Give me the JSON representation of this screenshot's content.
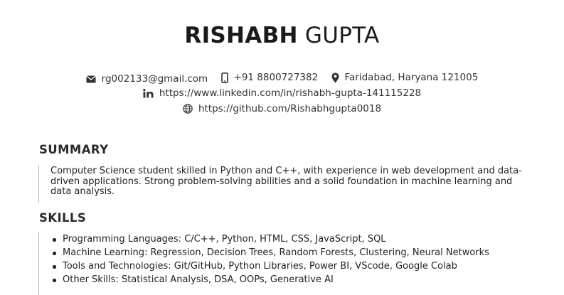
{
  "header": {
    "first_name": "RISHABH",
    "last_name": "GUPTA"
  },
  "contact": {
    "email": "rg002133@gmail.com",
    "phone": "+91 8800727382",
    "location": "Faridabad, Haryana 121005",
    "linkedin": "https://www.linkedin.com/in/rishabh-gupta-141115228",
    "github": "https://github.com/Rishabhgupta0018",
    "icons": [
      "envelope-icon",
      "phone-icon",
      "location-pin-icon",
      "linkedin-icon",
      "globe-icon"
    ]
  },
  "summary": {
    "title": "SUMMARY",
    "text": "Computer Science student skilled in Python and C++, with experience in web development and data-driven applications. Strong problem-solving abilities and a solid foundation in machine learning and data analysis."
  },
  "skills": {
    "title": "SKILLS",
    "items": [
      "Programming Languages: C/C++, Python, HTML, CSS, JavaScript, SQL",
      "Machine Learning: Regression, Decision Trees, Random Forests, Clustering, Neural Networks",
      "Tools and Technologies: Git/GitHub, Python Libraries, Power BI, VScode, Google Colab",
      "Other Skills: Statistical Analysis, DSA, OOPs, Generative AI"
    ]
  },
  "colors": {
    "text": "#222222",
    "divider": "#b8b8b8"
  }
}
